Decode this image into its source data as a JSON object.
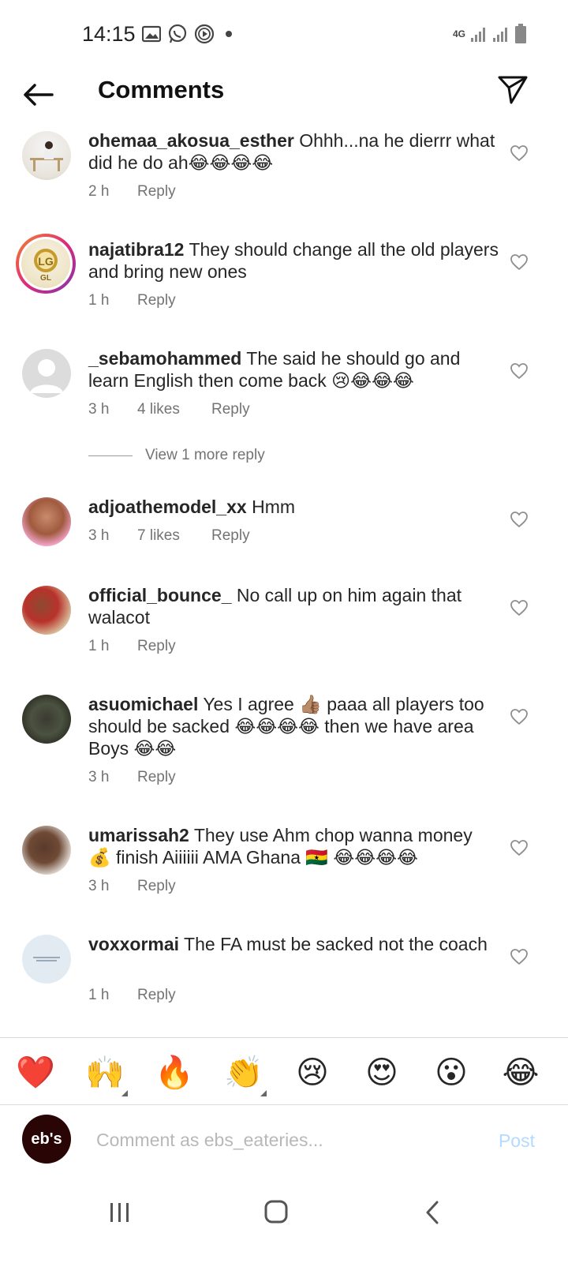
{
  "status_bar": {
    "time": "14:15",
    "network": "4G"
  },
  "header": {
    "title": "Comments"
  },
  "comments": [
    {
      "username": "ohemaa_akosua_esther",
      "text": "Ohhh...na he dierrr what did he do ah😂😂😂😂",
      "time": "2 h",
      "likes": "",
      "reply": "Reply"
    },
    {
      "username": "najatibra12",
      "text": "They should  change all the old players  and bring  new ones",
      "time": "1 h",
      "likes": "",
      "reply": "Reply"
    },
    {
      "username": "_sebamohammed",
      "text": "The said he should go and learn English then come back 😢😂😂😂",
      "time": "3 h",
      "likes": "4 likes",
      "reply": "Reply"
    },
    {
      "username": "adjoathemodel_xx",
      "text": "Hmm",
      "time": "3 h",
      "likes": "7 likes",
      "reply": "Reply"
    },
    {
      "username": "official_bounce_",
      "text": "No call up on him again that walacot",
      "time": "1 h",
      "likes": "",
      "reply": "Reply"
    },
    {
      "username": "asuomichael",
      "text": "Yes I agree 👍🏽 paaa all players too should be sacked 😂😂😂😂 then we have area Boys 😂😂",
      "time": "3 h",
      "likes": "",
      "reply": "Reply"
    },
    {
      "username": "umarissah2",
      "text": "They use Ahm chop wanna money 💰 finish Aiiiiii AMA Ghana 🇬🇭 😂😂😂😂",
      "time": "3 h",
      "likes": "",
      "reply": "Reply"
    },
    {
      "username": "voxxormai",
      "text": "The FA must be sacked not the coach",
      "time": "1 h",
      "likes": "",
      "reply": "Reply"
    }
  ],
  "view_more": "View 1 more reply",
  "avatar_labels": {
    "najatibra12": "GL",
    "my": "eb's"
  },
  "emoji_bar": [
    "❤️",
    "🙌",
    "🔥",
    "👏",
    "😢",
    "😍",
    "😮",
    "😂"
  ],
  "compose": {
    "placeholder": "Comment as ebs_eateries...",
    "post_label": "Post"
  },
  "colors": {
    "accent": "#0095f6",
    "post_disabled": "#b3dbff",
    "secondary_text": "#737373"
  }
}
